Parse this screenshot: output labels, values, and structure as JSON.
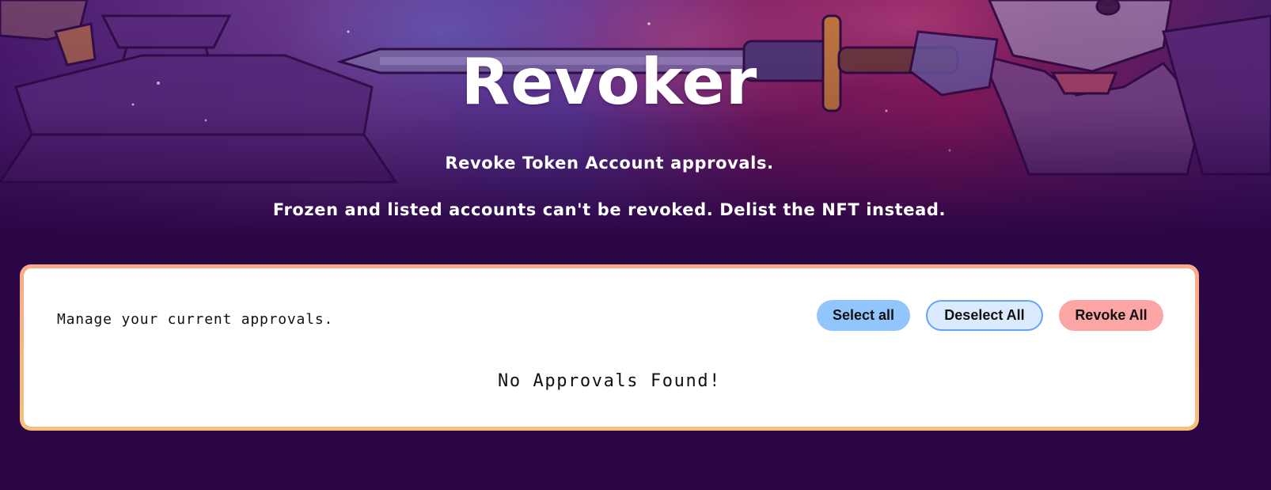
{
  "header": {
    "title": "Revoker",
    "subtitle": "Revoke Token Account approvals.",
    "note": "Frozen and listed accounts can't be revoked. Delist the NFT instead."
  },
  "approvals": {
    "heading": "Manage your current approvals.",
    "empty_message": "No Approvals Found!",
    "buttons": {
      "select_all": "Select all",
      "deselect_all": "Deselect All",
      "revoke_all": "Revoke All"
    }
  },
  "colors": {
    "page_background": "#2a0645",
    "card_border_top": "#fba98b",
    "card_border_bottom": "#f6c07a",
    "select_all_bg": "#93c5fd",
    "deselect_all_bg": "#dbeafe",
    "deselect_all_border": "#60a5fa",
    "revoke_all_bg": "#fca5a5"
  }
}
